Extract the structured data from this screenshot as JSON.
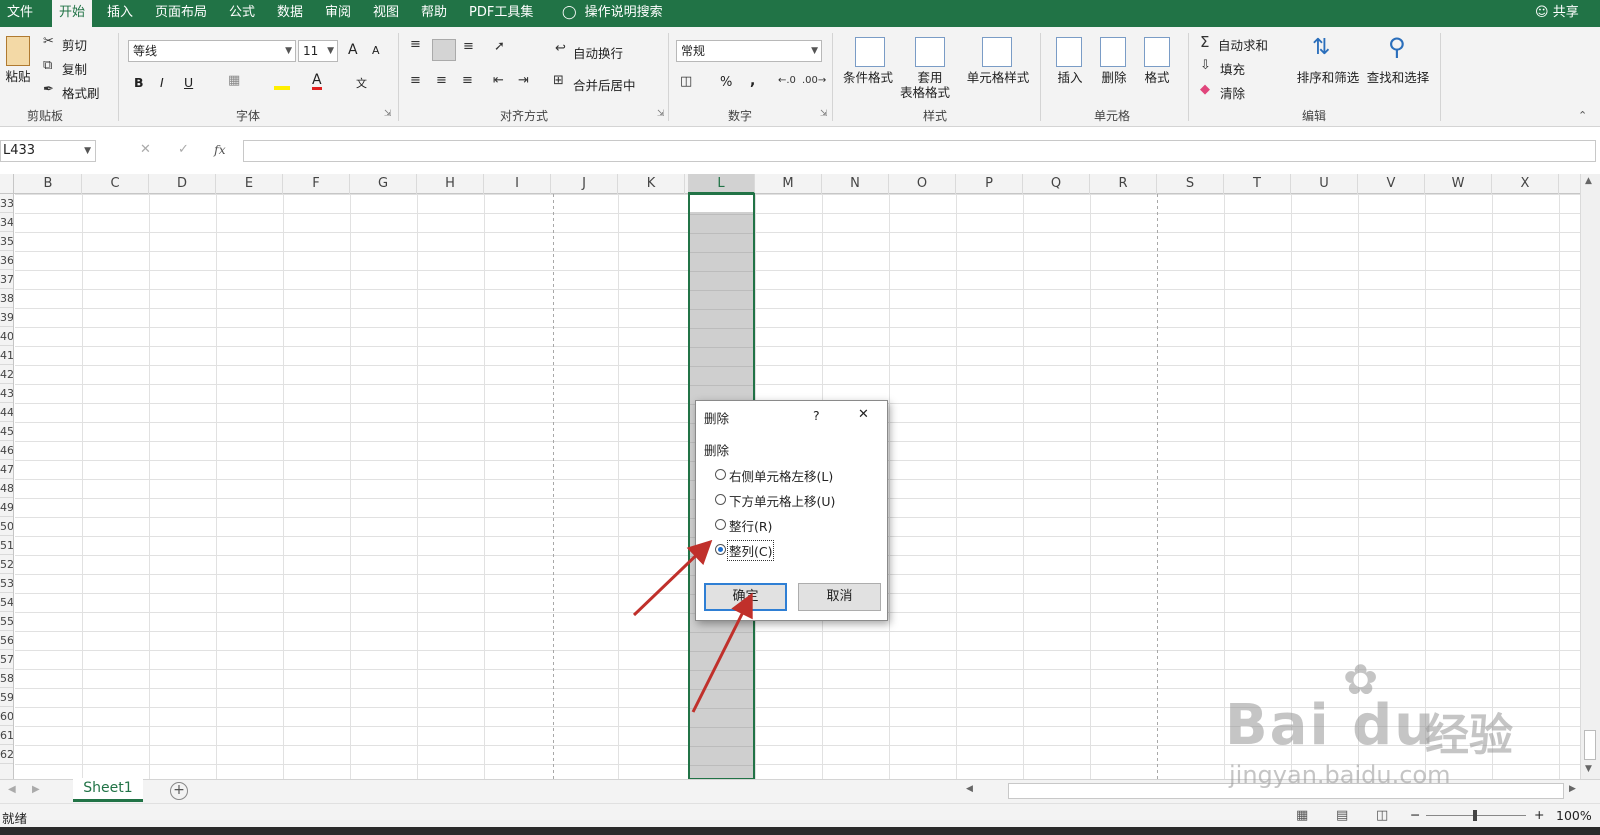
{
  "tabs": [
    "文件",
    "开始",
    "插入",
    "页面布局",
    "公式",
    "数据",
    "审阅",
    "视图",
    "帮助",
    "PDF工具集"
  ],
  "tell_me": "操作说明搜索",
  "share": "共享",
  "clipboard": {
    "paste": "粘贴",
    "cut": "剪切",
    "copy": "复制",
    "format_painter": "格式刷",
    "label": "剪贴板"
  },
  "font": {
    "name": "等线",
    "size": "11",
    "label": "字体",
    "bold": "B",
    "italic": "I",
    "underline": "U",
    "grow": "A",
    "shrink": "A",
    "color_letter": "A",
    "phonetic": "文"
  },
  "alignment": {
    "wrap": "自动换行",
    "merge": "合并后居中",
    "label": "对齐方式"
  },
  "number": {
    "format": "常规",
    "percent": "%",
    "comma": ",",
    "label": "数字"
  },
  "styles": {
    "conditional": "条件格式",
    "table_line1": "套用",
    "table_line2": "表格格式",
    "cell_styles": "单元格样式",
    "label": "样式"
  },
  "cells": {
    "insert": "插入",
    "delete": "删除",
    "format": "格式",
    "label": "单元格"
  },
  "editing": {
    "autosum": "自动求和",
    "fill": "填充",
    "clear": "清除",
    "sort": "排序和筛选",
    "find": "查找和选择",
    "label": "编辑"
  },
  "name_box": "L433",
  "fx": "fx",
  "columns": [
    "B",
    "C",
    "D",
    "E",
    "F",
    "G",
    "H",
    "I",
    "J",
    "K",
    "L",
    "M",
    "N",
    "O",
    "P",
    "Q",
    "R",
    "S",
    "T",
    "U",
    "V",
    "W",
    "X"
  ],
  "selected_column": "L",
  "rows": [
    "33",
    "34",
    "35",
    "36",
    "37",
    "38",
    "39",
    "40",
    "41",
    "42",
    "43",
    "44",
    "45",
    "46",
    "47",
    "48",
    "49",
    "50",
    "51",
    "52",
    "53",
    "54",
    "55",
    "56",
    "57",
    "58",
    "59",
    "60",
    "61",
    "62"
  ],
  "dialog": {
    "title": "删除",
    "help": "?",
    "close": "✕",
    "group_label": "删除",
    "options": [
      {
        "label": "右侧单元格左移(L)",
        "checked": false
      },
      {
        "label": "下方单元格上移(U)",
        "checked": false
      },
      {
        "label": "整行(R)",
        "checked": false
      },
      {
        "label": "整列(C)",
        "checked": true
      }
    ],
    "ok": "确定",
    "cancel": "取消"
  },
  "sheet_tab": "Sheet1",
  "add_sheet": "+",
  "status": {
    "ready": "就绪",
    "zoom": "100%",
    "minus": "−",
    "plus": "+"
  },
  "watermark": {
    "brand": "Bai du",
    "brand_cn": "经验",
    "url": "jingyan.baidu.com"
  },
  "colors": {
    "excel_green": "#217346",
    "annotation_arrow": "#c0302b",
    "selection": "#d2d2d2"
  }
}
